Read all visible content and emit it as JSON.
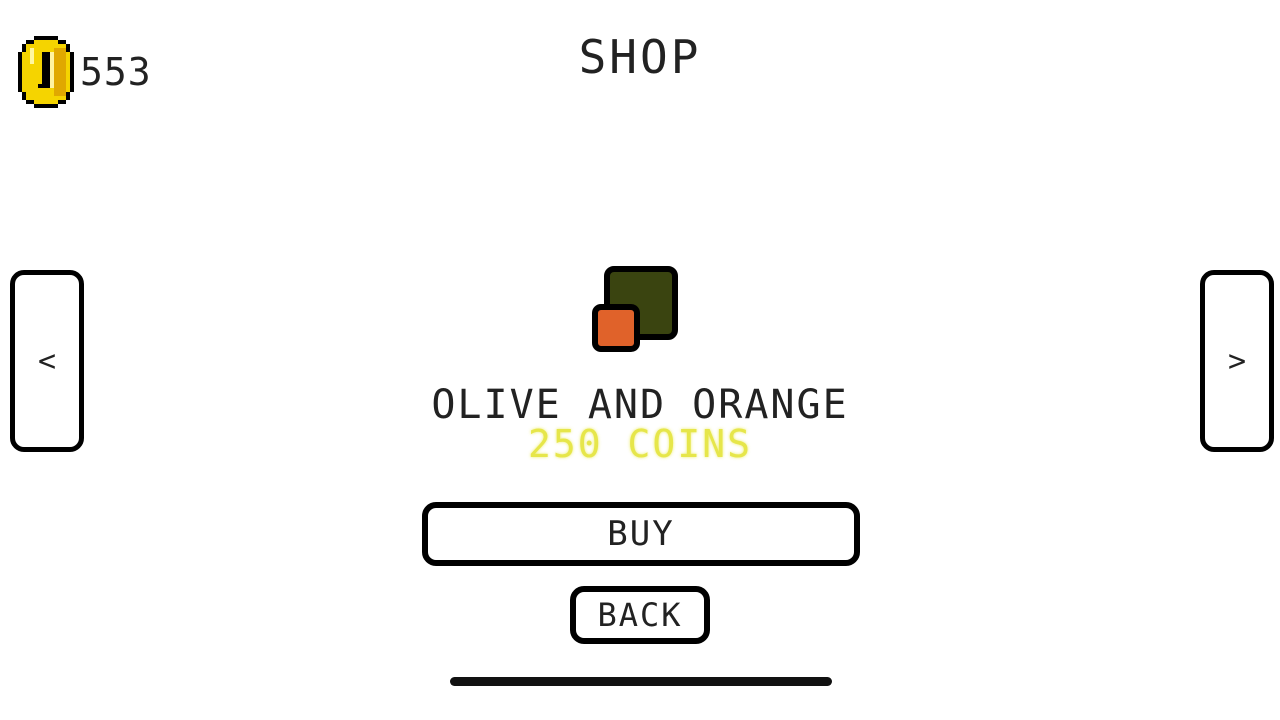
{
  "hud": {
    "coin_icon": "gold-coin-icon",
    "coin_count": "553"
  },
  "title": "SHOP",
  "nav": {
    "prev_label": "<",
    "next_label": ">"
  },
  "skin": {
    "name": "OLIVE AND ORANGE",
    "price": "250 COINS",
    "primary_color": "#3a4410",
    "secondary_color": "#e0622a"
  },
  "colors": {
    "price_text": "#e6e64a",
    "coin_gold": "#f5d400"
  },
  "buttons": {
    "buy_label": "BUY",
    "back_label": "BACK"
  }
}
